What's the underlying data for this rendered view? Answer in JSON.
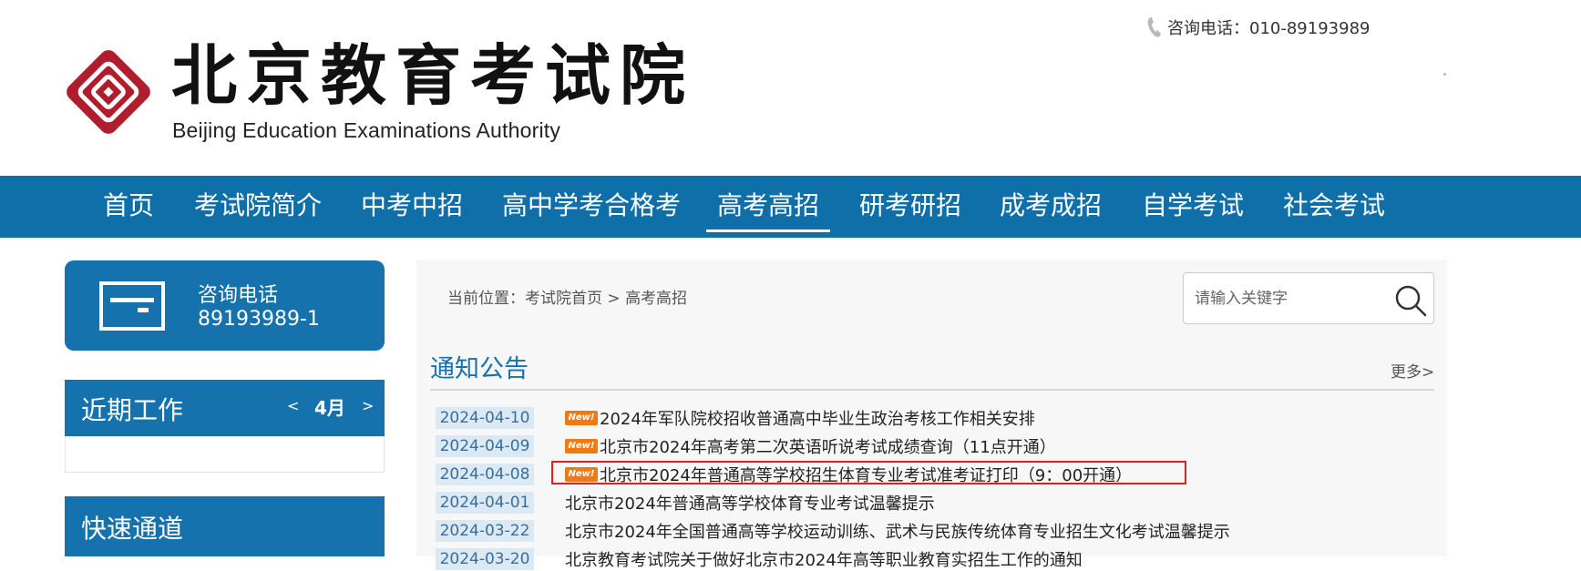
{
  "header": {
    "logo_cn": "北京教育考试院",
    "logo_en": "Beijing Education Examinations Authority",
    "phone_text": "咨询电话：010-89193989",
    "brand_color": "#b01e2e"
  },
  "nav": {
    "items": [
      {
        "label": "首页"
      },
      {
        "label": "考试院简介"
      },
      {
        "label": "中考中招"
      },
      {
        "label": "高中学考合格考"
      },
      {
        "label": "高考高招"
      },
      {
        "label": "研考研招"
      },
      {
        "label": "成考成招"
      },
      {
        "label": "自学考试"
      },
      {
        "label": "社会考试"
      }
    ],
    "active": "高考高招",
    "bg_color": "#0f6fa9"
  },
  "sidebar": {
    "hotline": {
      "label": "咨询电话",
      "number": "89193989-1",
      "icon": "card-icon"
    },
    "recent_work": {
      "title": "近期工作",
      "prev": "<",
      "month": "4月",
      "next": ">"
    },
    "quick_access": {
      "title": "快速通道"
    }
  },
  "main": {
    "breadcrumb": {
      "prefix": "当前位置：",
      "home": "考试院首页",
      "sep": " > ",
      "current": "高考高招"
    },
    "search": {
      "placeholder": "请输入关键字",
      "icon": "search-icon"
    },
    "notice": {
      "title": "通知公告",
      "more": "更多>",
      "badge_label": "New!",
      "items": [
        {
          "date": "2024-04-10",
          "title": "2024年军队院校招收普通高中毕业生政治考核工作相关安排",
          "new": true
        },
        {
          "date": "2024-04-09",
          "title": "北京市2024年高考第二次英语听说考试成绩查询（11点开通）",
          "new": true
        },
        {
          "date": "2024-04-08",
          "title": "北京市2024年普通高等学校招生体育专业考试准考证打印（9：00开通）",
          "new": true
        },
        {
          "date": "2024-04-01",
          "title": "北京市2024年普通高等学校体育专业考试温馨提示",
          "new": false
        },
        {
          "date": "2024-03-22",
          "title": "北京市2024年全国普通高等学校运动训练、武术与民族传统体育专业招生文化考试温馨提示",
          "new": false
        },
        {
          "date": "2024-03-20",
          "title": "北京教育考试院关于做好北京市2024年高等职业教育实招生工作的通知",
          "new": false
        }
      ],
      "highlight_color": "#e02020"
    }
  }
}
